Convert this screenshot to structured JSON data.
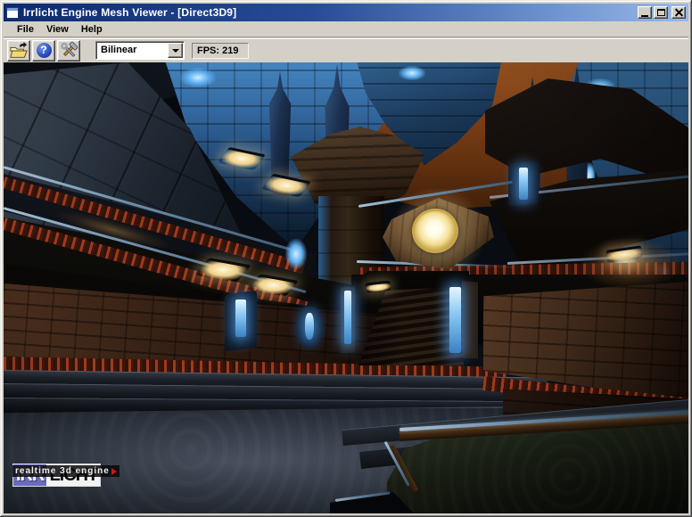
{
  "window": {
    "title": "Irrlicht Engine Mesh Viewer - [Direct3D9]"
  },
  "menu": {
    "items": [
      {
        "label": "File"
      },
      {
        "label": "View"
      },
      {
        "label": "Help"
      }
    ]
  },
  "toolbar": {
    "buttons": [
      {
        "icon": "open-folder-icon"
      },
      {
        "icon": "help-icon",
        "glyph": "?"
      },
      {
        "icon": "tools-icon"
      }
    ],
    "texture_filter": {
      "value": "Bilinear"
    },
    "fps": "FPS: 219"
  },
  "viewport": {
    "colors": {
      "sky": "#7d3f16",
      "stone_blue": "#32669c",
      "glow_blue": "#8fd0ff",
      "lamp_warm": "#ffe8a8",
      "floor": "#3a424e",
      "rust_trim": "#8a2f16"
    }
  },
  "logo": {
    "irr": "IRR",
    "licht": "LICHT",
    "tagline": "realtime 3d engine"
  }
}
